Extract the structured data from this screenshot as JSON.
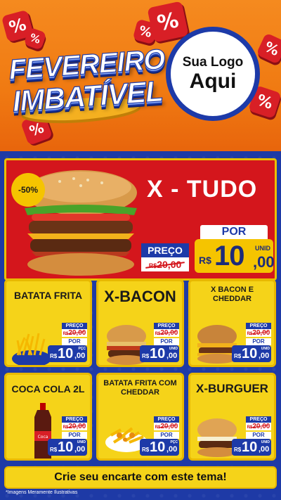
{
  "header": {
    "title_line1": "FEVEREIRO",
    "title_line2": "IMBATÍVEL",
    "logo_line1": "Sua Logo",
    "logo_line2": "Aqui",
    "percent_symbol": "%"
  },
  "hero": {
    "discount": "-50%",
    "name": "X - TUDO",
    "preco_label": "PREÇO",
    "old_currency": "R$",
    "old_price": "20,00",
    "por_label": "POR",
    "currency": "R$",
    "price_int": "10",
    "price_dec": ",00",
    "unit": "UNID"
  },
  "cards": [
    {
      "name": "BATATA FRITA",
      "preco_label": "PREÇO",
      "old_currency": "R$",
      "old_price": "20,00",
      "por_label": "POR",
      "currency": "R$",
      "price_int": "10",
      "price_dec": ",00",
      "unit": "PÇC"
    },
    {
      "name": "X-BACON",
      "preco_label": "PREÇO",
      "old_currency": "R$",
      "old_price": "20,00",
      "por_label": "POR",
      "currency": "R$",
      "price_int": "10",
      "price_dec": ",00",
      "unit": "UNID"
    },
    {
      "name": "X BACON E CHEDDAR",
      "preco_label": "PREÇO",
      "old_currency": "R$",
      "old_price": "20,00",
      "por_label": "POR",
      "currency": "R$",
      "price_int": "10",
      "price_dec": ",00",
      "unit": "UNID"
    },
    {
      "name": "COCA COLA 2L",
      "preco_label": "PREÇO",
      "old_currency": "R$",
      "old_price": "20,00",
      "por_label": "POR",
      "currency": "R$",
      "price_int": "10",
      "price_dec": ",00",
      "unit": "UNID"
    },
    {
      "name": "BATATA FRITA COM CHEDDAR",
      "preco_label": "PREÇO",
      "old_currency": "R$",
      "old_price": "20,00",
      "por_label": "POR",
      "currency": "R$",
      "price_int": "10",
      "price_dec": ",00",
      "unit": "PÇC"
    },
    {
      "name": "X-BURGUER",
      "preco_label": "PREÇO",
      "old_currency": "R$",
      "old_price": "20,00",
      "por_label": "POR",
      "currency": "R$",
      "price_int": "10",
      "price_dec": ",00",
      "unit": "UNID"
    }
  ],
  "footer": {
    "cta": "Crie seu encarte com este tema!",
    "disclaimer": "*Imagens Meramente Ilustrativas"
  },
  "colors": {
    "orange": "#f07a12",
    "blue": "#1d3aa8",
    "red": "#d4161c",
    "yellow": "#f5d319"
  }
}
